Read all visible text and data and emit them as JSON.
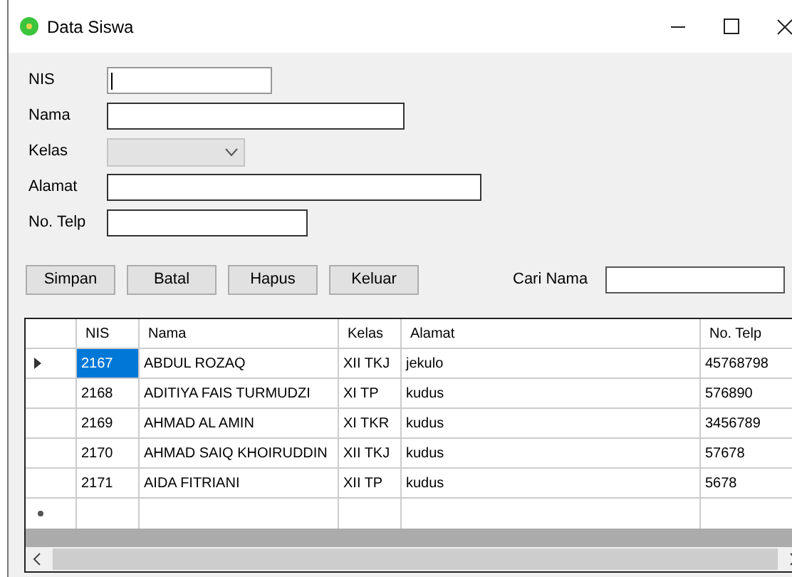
{
  "window": {
    "title": "Data Siswa"
  },
  "form": {
    "fields": [
      {
        "kind": "text",
        "label": "NIS",
        "focused": true
      },
      {
        "kind": "text",
        "label": "Nama",
        "focused": false
      },
      {
        "kind": "combo",
        "label": "Kelas",
        "disabled": true
      },
      {
        "kind": "text",
        "label": "Alamat",
        "focused": false
      },
      {
        "kind": "text",
        "label": "No. Telp",
        "focused": false
      }
    ]
  },
  "buttons": [
    "Simpan",
    "Batal",
    "Hapus",
    "Keluar"
  ],
  "search": {
    "label": "Cari Nama"
  },
  "table": {
    "columns": [
      "NIS",
      "Nama",
      "Kelas",
      "Alamat",
      "No. Telp"
    ],
    "rows": [
      {
        "cells": [
          "2167",
          "ABDUL ROZAQ",
          "XII TKJ",
          "jekulo",
          "45768798"
        ],
        "selected": true
      },
      {
        "cells": [
          "2168",
          "ADITIYA FAIS TURMUDZI",
          "XI TP",
          "kudus",
          "576890"
        ],
        "selected": false
      },
      {
        "cells": [
          "2169",
          "AHMAD AL AMIN",
          "XI TKR",
          "kudus",
          "3456789"
        ],
        "selected": false
      },
      {
        "cells": [
          "2170",
          "AHMAD SAIQ KHOIRUDDIN",
          "XII TKJ",
          "kudus",
          "57678"
        ],
        "selected": false
      },
      {
        "cells": [
          "2171",
          "AIDA FITRIANI",
          "XII TP",
          "kudus",
          "5678"
        ],
        "selected": false
      }
    ]
  }
}
